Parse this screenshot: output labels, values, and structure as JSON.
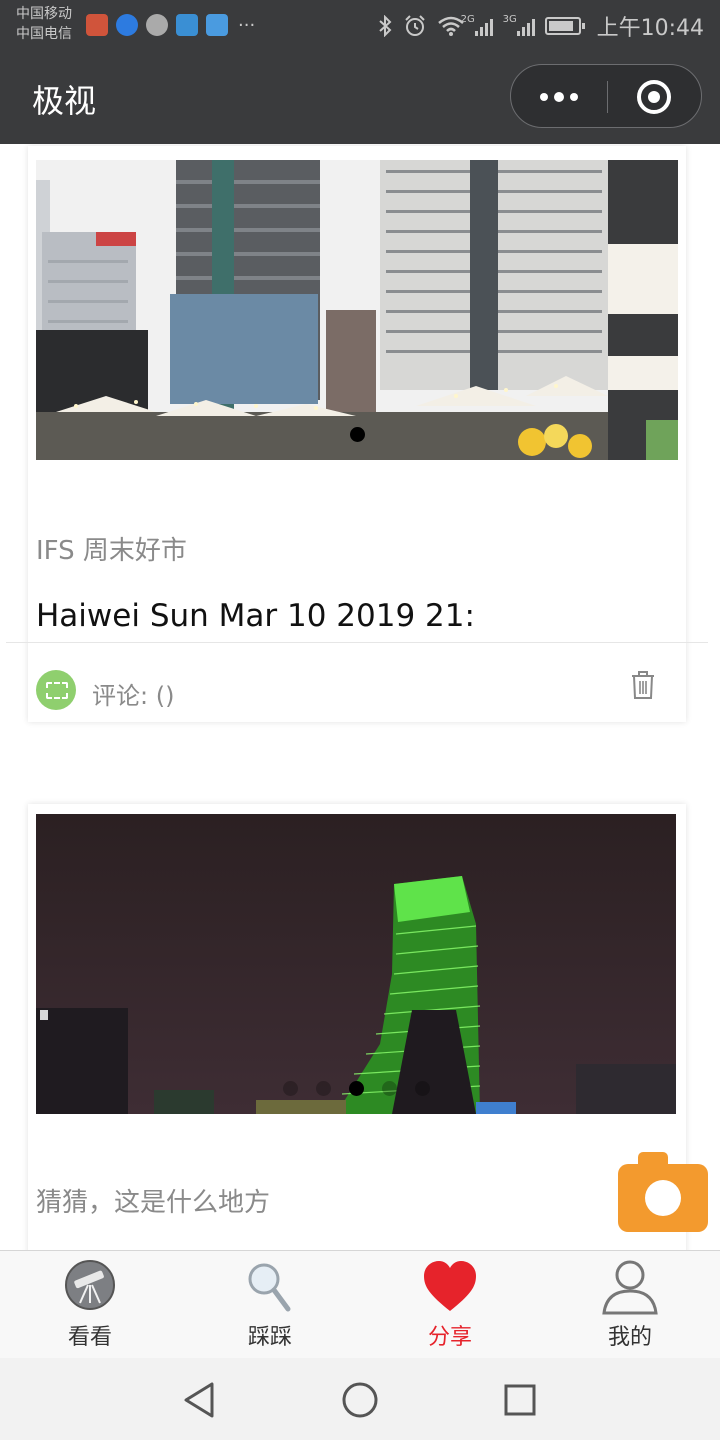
{
  "status_bar": {
    "carrier1": "中国移动",
    "carrier2": "中国电信",
    "network1": "2G",
    "network2": "3G",
    "time": "上午10:44"
  },
  "title_bar": {
    "title": "极视"
  },
  "posts": [
    {
      "caption": "IFS 周末好市",
      "author_line": "Haiwei Sun Mar 10 2019 21:",
      "comment_label": "评论: ()",
      "carousel_index": 0,
      "carousel_count": 1
    },
    {
      "caption": "猜猜，这是什么地方",
      "carousel_index": 2,
      "carousel_count": 5
    }
  ],
  "tabs": [
    {
      "label": "看看",
      "icon": "telescope-icon",
      "active": false
    },
    {
      "label": "踩踩",
      "icon": "magnifier-icon",
      "active": false
    },
    {
      "label": "分享",
      "icon": "heart-icon",
      "active": true
    },
    {
      "label": "我的",
      "icon": "person-icon",
      "active": false
    }
  ],
  "colors": {
    "header_bg": "#3a3b3d",
    "active_tab": "#e6232b",
    "comment_icon": "#8fcf6e",
    "camera_fab": "#f39a2e"
  }
}
